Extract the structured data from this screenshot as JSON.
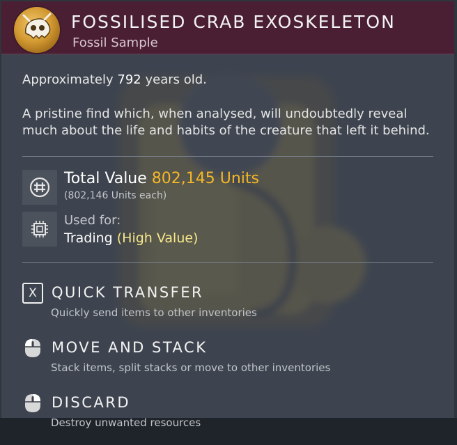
{
  "item": {
    "title": "FOSSILISED CRAB EXOSKELETON",
    "subtitle": "Fossil Sample",
    "icon": "crab-skull-fossil-icon",
    "age_prefix": "Approximately",
    "age_years": "792",
    "age_suffix": "years old.",
    "description": "A pristine find which, when analysed, will undoubtedly reveal much about the life and habits of the creature that left it behind."
  },
  "value": {
    "label": "Total Value",
    "amount": "802,145 Units",
    "each": "(802,146 Units each)",
    "icon": "units-currency-icon"
  },
  "usage": {
    "label": "Used for:",
    "value": "Trading",
    "highlight": "(High Value)",
    "icon": "trading-chip-icon"
  },
  "actions": [
    {
      "key": "X",
      "title": "QUICK TRANSFER",
      "description": "Quickly send items to other inventories",
      "icon": "x-key-icon"
    },
    {
      "key": "",
      "title": "MOVE AND STACK",
      "description": "Stack items, split stacks or move to other inventories",
      "icon": "mouse-left-click-icon"
    },
    {
      "key": "",
      "title": "DISCARD",
      "description": "Destroy unwanted resources",
      "icon": "mouse-right-click-icon"
    }
  ],
  "colors": {
    "header": "#4a1f33",
    "panel": "#424954",
    "value_accent": "#f4b728",
    "usage_accent": "#f7e98a"
  }
}
